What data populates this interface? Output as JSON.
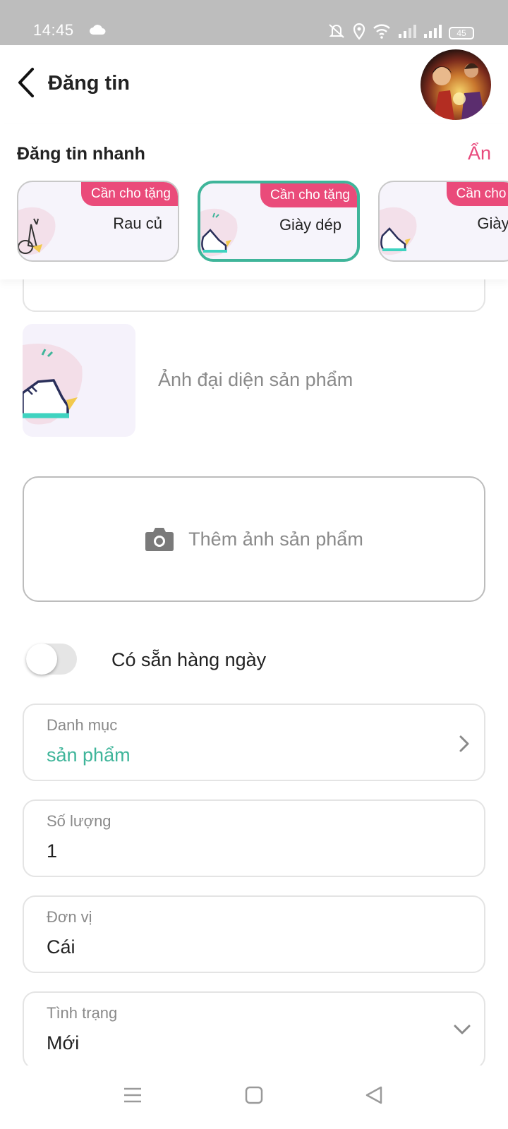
{
  "status_bar": {
    "time": "14:45",
    "battery": "45",
    "icons": [
      "cloud-icon",
      "mute-icon",
      "location-icon",
      "wifi-icon",
      "signal-icon",
      "signal-icon",
      "battery-icon"
    ]
  },
  "header": {
    "title": "Đăng tin"
  },
  "quick_post": {
    "title": "Đăng tin nhanh",
    "hide_label": "Ẩn",
    "cards": [
      {
        "tag": "Cần cho tặng",
        "label": "Rau củ"
      },
      {
        "tag": "Cần cho tặng",
        "label": "Giày dép",
        "selected": true
      },
      {
        "tag": "Cần cho t",
        "label": "Giày d"
      }
    ]
  },
  "form": {
    "thumbnail_label": "Ảnh đại diện sản phẩm",
    "add_photo_label": "Thêm ảnh sản phẩm",
    "daily_toggle": {
      "label": "Có sẵn hàng ngày",
      "on": false
    },
    "category": {
      "label": "Danh mục",
      "value": "sản phẩm"
    },
    "quantity": {
      "label": "Số lượng",
      "value": "1"
    },
    "unit": {
      "label": "Đơn vị",
      "value": "Cái"
    },
    "condition": {
      "label": "Tình trạng",
      "value": "Mới"
    }
  },
  "colors": {
    "accent_pink": "#ea4b7a",
    "accent_green": "#3fb59a",
    "status_bar": "#bdbdbd"
  }
}
